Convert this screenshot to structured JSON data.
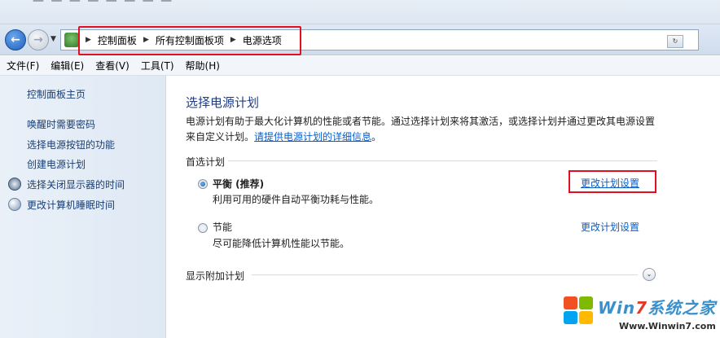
{
  "address_bar": {
    "crumbs": [
      "控制面板",
      "所有控制面板项",
      "电源选项"
    ],
    "back_icon": "back-arrow-icon",
    "forward_icon": "forward-arrow-icon"
  },
  "menu": [
    "文件(F)",
    "编辑(E)",
    "查看(V)",
    "工具(T)",
    "帮助(H)"
  ],
  "sidebar": {
    "home": "控制面板主页",
    "links": [
      "唤醒时需要密码",
      "选择电源按钮的功能",
      "创建电源计划",
      "选择关闭显示器的时间",
      "更改计算机睡眠时间"
    ]
  },
  "main": {
    "title": "选择电源计划",
    "description_line1": "电源计划有助于最大化计算机的性能或者节能。通过选择计划来将其激活，或选择计划并通过更改其电源设置",
    "description_line2": "来自定义计划。",
    "description_link": "请提供电源计划的详细信息",
    "description_end": "。",
    "section_label": "首选计划",
    "plans": [
      {
        "name": "平衡 (推荐)",
        "desc": "利用可用的硬件自动平衡功耗与性能。",
        "link": "更改计划设置",
        "selected": true
      },
      {
        "name": "节能",
        "desc": "尽可能降低计算机性能以节能。",
        "link": "更改计划设置",
        "selected": false
      }
    ],
    "more_plans": "显示附加计划"
  },
  "watermark": {
    "brand_pre": "Win",
    "brand_num": "7",
    "brand_post": "系统之家",
    "url": "Www.Winwin7.com"
  },
  "colors": {
    "highlight": "#e01020",
    "link": "#0a5ec9",
    "title": "#1e3c86"
  }
}
